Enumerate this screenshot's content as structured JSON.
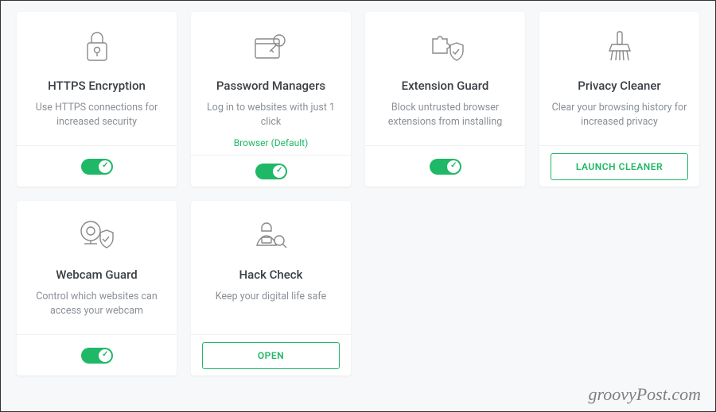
{
  "cards": [
    {
      "icon": "lock-icon",
      "title": "HTTPS Encryption",
      "desc": "Use HTTPS connections for increased security",
      "sub": "",
      "action": {
        "type": "toggle",
        "on": true
      }
    },
    {
      "icon": "key-browser-icon",
      "title": "Password Managers",
      "desc": "Log in to websites with just 1 click",
      "sub": "Browser (Default)",
      "action": {
        "type": "toggle",
        "on": true
      }
    },
    {
      "icon": "puzzle-shield-icon",
      "title": "Extension Guard",
      "desc": "Block untrusted browser extensions from installing",
      "sub": "",
      "action": {
        "type": "toggle",
        "on": true
      }
    },
    {
      "icon": "brush-icon",
      "title": "Privacy Cleaner",
      "desc": "Clear your browsing history for increased privacy",
      "sub": "",
      "action": {
        "type": "button",
        "label": "LAUNCH CLEANER"
      }
    },
    {
      "icon": "webcam-shield-icon",
      "title": "Webcam Guard",
      "desc": "Control which websites can access your webcam",
      "sub": "",
      "action": {
        "type": "toggle",
        "on": true
      }
    },
    {
      "icon": "hacker-icon",
      "title": "Hack Check",
      "desc": "Keep your digital life safe",
      "sub": "",
      "action": {
        "type": "button",
        "label": "OPEN"
      }
    }
  ],
  "watermark": "groovyPost.com"
}
